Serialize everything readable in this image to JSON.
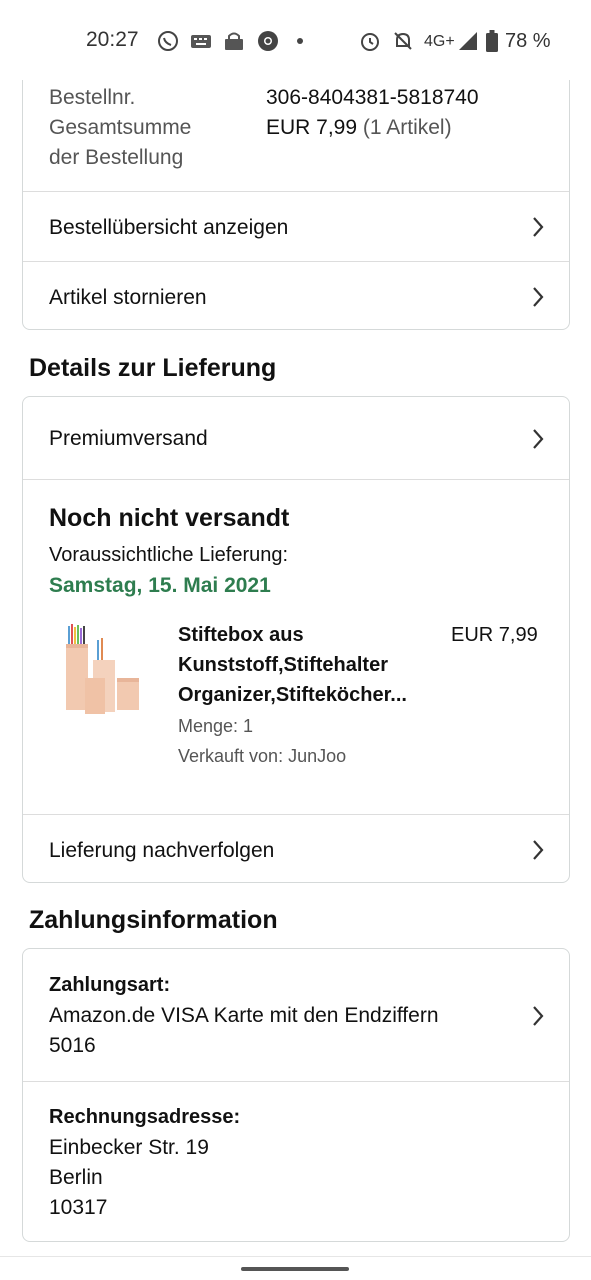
{
  "status_bar": {
    "time": "20:27",
    "network": "4G+",
    "battery": "78 %",
    "icons": [
      "whatsapp-icon",
      "keyboard-icon",
      "vpn-key-icon",
      "chrome-icon",
      "dot-icon",
      "alarm-icon",
      "mute-bell-icon",
      "signal-icon",
      "battery-icon"
    ]
  },
  "order": {
    "order_no_label": "Bestellnr.",
    "order_no_value": "306-8404381-5818740",
    "total_label_line1": "Gesamtsumme",
    "total_label_line2": "der Bestellung",
    "total_value": "EUR 7,99",
    "total_count": "(1 Artikel)",
    "view_summary": "Bestellübersicht anzeigen",
    "cancel_items": "Artikel stornieren"
  },
  "delivery": {
    "section_title": "Details zur Lieferung",
    "shipping_method": "Premiumversand",
    "status": "Noch nicht versandt",
    "expected_label": "Voraussichtliche Lieferung:",
    "expected_date": "Samstag, 15. Mai 2021",
    "product": {
      "title_line1": "Stiftebox aus",
      "title_line2": "Kunststoff,Stiftehalter",
      "title_line3": "Organizer,Stifteköcher...",
      "price": "EUR 7,99",
      "quantity": "Menge: 1",
      "seller": "Verkauft von: JunJoo"
    },
    "track": "Lieferung nachverfolgen"
  },
  "payment": {
    "section_title": "Zahlungsinformation",
    "method_label": "Zahlungsart:",
    "method_line1": "Amazon.de VISA Karte mit den Endziffern",
    "method_line2": "5016",
    "billing_label": "Rechnungsadresse:",
    "street": "Einbecker Str. 19",
    "city": "Berlin",
    "zip": "10317"
  },
  "colors": {
    "green": "#2e7d4f",
    "border": "#d5d9d9"
  }
}
